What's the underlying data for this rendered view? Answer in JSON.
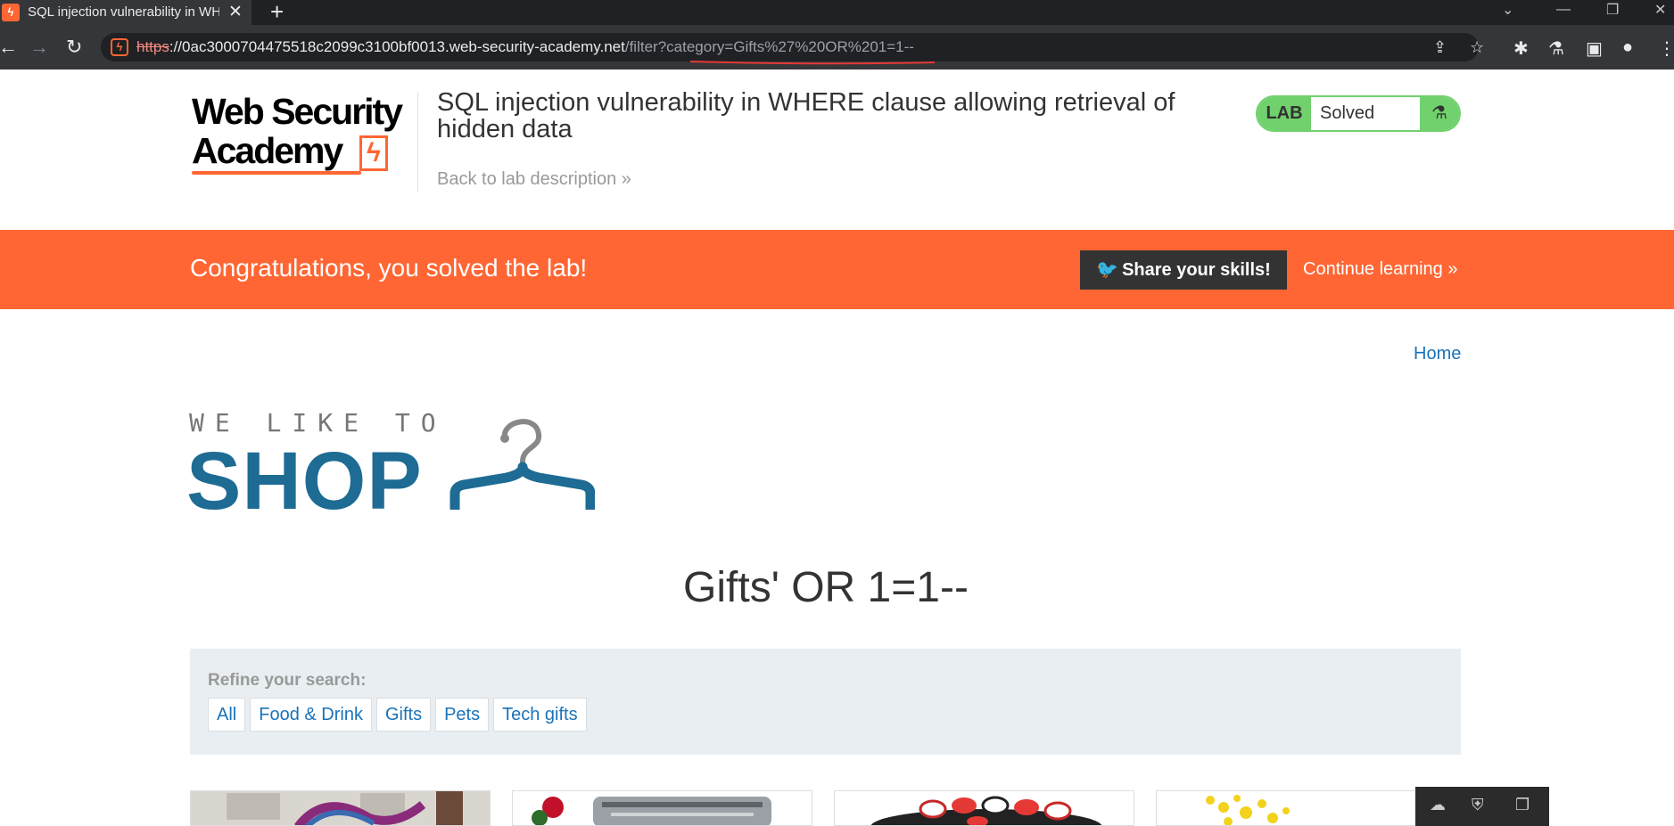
{
  "browser": {
    "tab_title": "SQL injection vulnerability in WH",
    "favicon_glyph": "ϟ",
    "close_glyph": "✕",
    "new_tab_glyph": "+",
    "url_proto": "https",
    "url_host": "://0ac3000704475518c2099c3100bf0013.web-security-academy.net",
    "url_path": "/filter?category=Gifts%27%20OR%201=1--",
    "win_chevron": "⌄",
    "win_min": "—",
    "win_restore": "❐",
    "win_close": "✕",
    "back_glyph": "←",
    "forward_glyph": "→",
    "reload_glyph": "↻",
    "share_glyph": "⇪",
    "star_glyph": "☆",
    "extensions_glyph": "✱",
    "lab_glyph": "⚗",
    "sidepanel_glyph": "▣",
    "profile_glyph": "●",
    "menu_glyph": "⋮"
  },
  "lab": {
    "logo_line1": "Web Security",
    "logo_line2": "Academy",
    "logo_bolt": "ϟ",
    "title": "SQL injection vulnerability in WHERE clause allowing retrieval of hidden data",
    "back_link": "Back to lab description »",
    "badge_label": "LAB",
    "badge_status": "Solved",
    "badge_flask": "⚗"
  },
  "banner": {
    "message": "Congratulations, you solved the lab!",
    "share_button": "Share your skills!",
    "continue_link": "Continue learning »"
  },
  "shop": {
    "home_link": "Home",
    "logo_top": "WE LIKE TO",
    "logo_main": "SHOP",
    "category_heading": "Gifts' OR 1=1--",
    "refine_label": "Refine your search:",
    "filters": [
      "All",
      "Food & Drink",
      "Gifts",
      "Pets",
      "Tech gifts"
    ]
  },
  "colors": {
    "accent_orange": "#ff6633",
    "solved_green": "#70d16d",
    "shop_blue": "#1e6b94",
    "link_blue": "#1a73b8"
  }
}
